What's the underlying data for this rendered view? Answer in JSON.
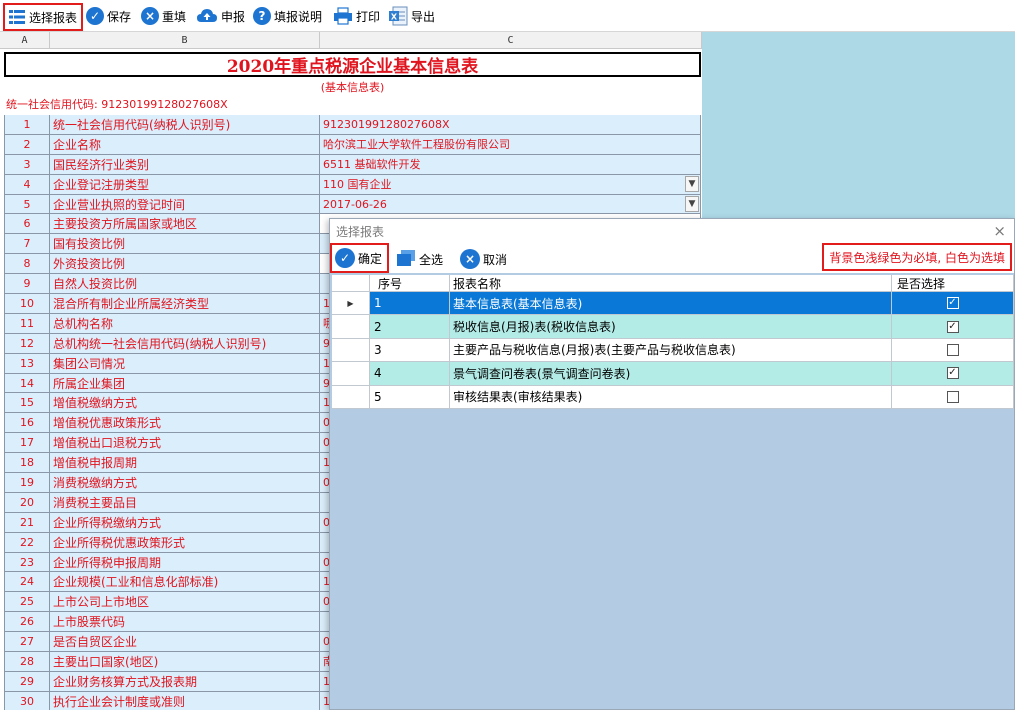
{
  "toolbar": {
    "buttons": [
      {
        "label": "选择报表",
        "icon": "list-icon"
      },
      {
        "label": "保存",
        "icon": "check-icon"
      },
      {
        "label": "重填",
        "icon": "clear-icon"
      },
      {
        "label": "申报",
        "icon": "cloud-upload-icon"
      },
      {
        "label": "填报说明",
        "icon": "help-icon"
      },
      {
        "label": "打印",
        "icon": "printer-icon"
      },
      {
        "label": "导出",
        "icon": "excel-icon"
      }
    ]
  },
  "sheet": {
    "columns": [
      "A",
      "B",
      "C"
    ],
    "title": "2020年重点税源企业基本信息表",
    "subtitle": "(基本信息表)",
    "credit_code_line": "统一社会信用代码: 91230199128027608X",
    "rows": [
      {
        "no": "1",
        "name": "统一社会信用代码(纳税人识别号)",
        "value": "91230199128027608X"
      },
      {
        "no": "2",
        "name": "企业名称",
        "value": "哈尔滨工业大学软件工程股份有限公司"
      },
      {
        "no": "3",
        "name": "国民经济行业类别",
        "value": "6511 基础软件开发"
      },
      {
        "no": "4",
        "name": "企业登记注册类型",
        "value": "110 国有企业"
      },
      {
        "no": "5",
        "name": "企业营业执照的登记时间",
        "value": "2017-06-26"
      },
      {
        "no": "6",
        "name": "主要投资方所属国家或地区",
        "value": ""
      },
      {
        "no": "7",
        "name": "国有投资比例",
        "value": ""
      },
      {
        "no": "8",
        "name": "外资投资比例",
        "value": ""
      },
      {
        "no": "9",
        "name": "自然人投资比例",
        "value": ""
      },
      {
        "no": "10",
        "name": "混合所有制企业所属经济类型",
        "value": "1"
      },
      {
        "no": "11",
        "name": "总机构名称",
        "value": "哪"
      },
      {
        "no": "12",
        "name": "总机构统一社会信用代码(纳税人识别号)",
        "value": "9"
      },
      {
        "no": "13",
        "name": "集团公司情况",
        "value": "1"
      },
      {
        "no": "14",
        "name": "所属企业集团",
        "value": "9"
      },
      {
        "no": "15",
        "name": "增值税缴纳方式",
        "value": "1"
      },
      {
        "no": "16",
        "name": "增值税优惠政策形式",
        "value": "0"
      },
      {
        "no": "17",
        "name": "增值税出口退税方式",
        "value": "0"
      },
      {
        "no": "18",
        "name": "增值税申报周期",
        "value": "1"
      },
      {
        "no": "19",
        "name": "消费税缴纳方式",
        "value": "0"
      },
      {
        "no": "20",
        "name": "消费税主要品目",
        "value": ""
      },
      {
        "no": "21",
        "name": "企业所得税缴纳方式",
        "value": "0"
      },
      {
        "no": "22",
        "name": "企业所得税优惠政策形式",
        "value": ""
      },
      {
        "no": "23",
        "name": "企业所得税申报周期",
        "value": "0"
      },
      {
        "no": "24",
        "name": "企业规模(工业和信息化部标准)",
        "value": "1"
      },
      {
        "no": "25",
        "name": "上市公司上市地区",
        "value": "0"
      },
      {
        "no": "26",
        "name": "上市股票代码",
        "value": ""
      },
      {
        "no": "27",
        "name": "是否自贸区企业",
        "value": "0"
      },
      {
        "no": "28",
        "name": "主要出口国家(地区)",
        "value": "南"
      },
      {
        "no": "29",
        "name": "企业财务核算方式及报表期",
        "value": "1"
      },
      {
        "no": "30",
        "name": "执行企业会计制度或准则",
        "value": "1"
      }
    ]
  },
  "dialog": {
    "title": "选择报表",
    "close": "×",
    "buttons": {
      "confirm": "确定",
      "select_all": "全选",
      "cancel": "取消"
    },
    "note": "背景色浅绿色为必填, 白色为选填",
    "headers": {
      "no": "序号",
      "name": "报表名称",
      "selected": "是否选择"
    },
    "row_indicator": "▶",
    "rows": [
      {
        "no": "1",
        "name": "基本信息表(基本信息表)",
        "checked": true,
        "check_mark": "✓"
      },
      {
        "no": "2",
        "name": "税收信息(月报)表(税收信息表)",
        "checked": true,
        "check_mark": "✓"
      },
      {
        "no": "3",
        "name": "主要产品与税收信息(月报)表(主要产品与税收信息表)",
        "checked": false,
        "check_mark": ""
      },
      {
        "no": "4",
        "name": "景气调查问卷表(景气调查问卷表)",
        "checked": true,
        "check_mark": "✓"
      },
      {
        "no": "5",
        "name": "审核结果表(审核结果表)",
        "checked": false,
        "check_mark": ""
      }
    ]
  },
  "colors": {
    "required_bg": "#b3ebe6",
    "optional_bg": "#ffffff",
    "selected_row": "#0a78d7",
    "label_red": "#e0141e",
    "highlight_border": "#e21b1b"
  }
}
